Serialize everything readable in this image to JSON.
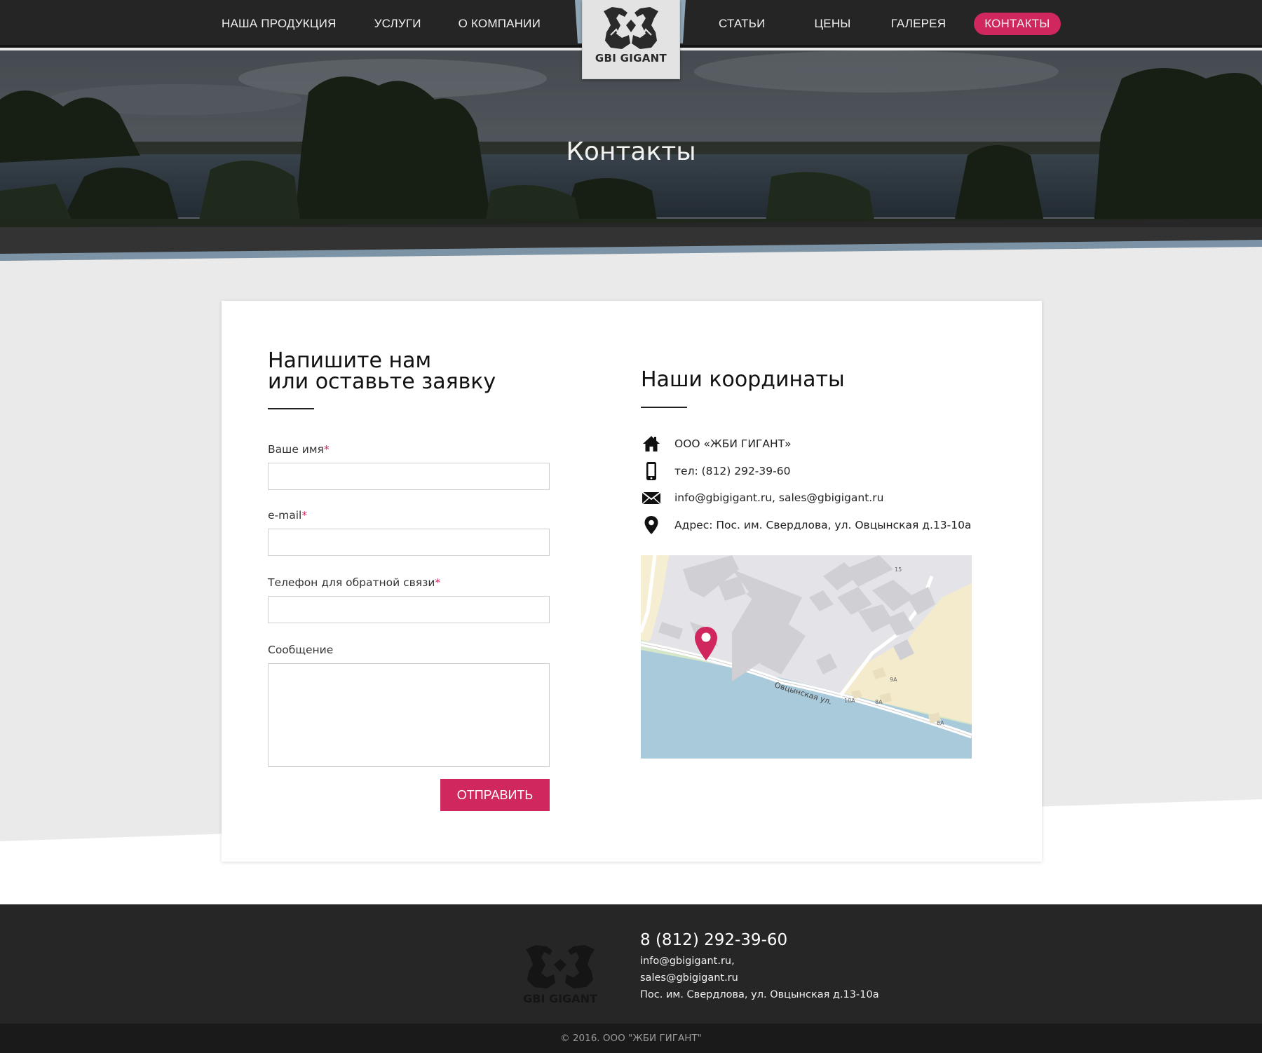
{
  "nav": {
    "left": [
      "НАША ПРОДУКЦИЯ",
      "УСЛУГИ",
      "О КОМПАНИИ"
    ],
    "right": [
      "СТАТЬИ",
      "ЦЕНЫ",
      "ГАЛЕРЕЯ"
    ],
    "active": "КОНТАКТЫ"
  },
  "logo": {
    "text": "GBI GIGANT"
  },
  "hero": {
    "title": "Контакты"
  },
  "form": {
    "title_line1": "Напишите нам",
    "title_line2": "или оставьте заявку",
    "name_label": "Ваше имя",
    "email_label": "e-mail",
    "phone_label": "Телефон для обратной связи",
    "message_label": "Сообщение",
    "required_mark": "*",
    "name_value": "",
    "email_value": "",
    "phone_value": "",
    "message_value": "",
    "submit": "ОТПРАВИТЬ"
  },
  "coords": {
    "title": "Наши координаты",
    "company": "ООО «ЖБИ ГИГАНТ»",
    "phone": "тел: (812) 292-39-60",
    "email": "info@gbigigant.ru, sales@gbigigant.ru",
    "address": "Адрес: Пос. им. Свердлова, ул. Овцынская д.13-10а",
    "icons": [
      "home-icon",
      "mobile-phone-icon",
      "envelope-icon",
      "map-pin-icon"
    ]
  },
  "map": {
    "street": "Овцынская ул.",
    "labels": [
      "15",
      "9А",
      "10А",
      "8А",
      "6А"
    ]
  },
  "footer": {
    "phone": "8 (812) 292-39-60",
    "email1": "info@gbigigant.ru,",
    "email2": "sales@gbigigant.ru",
    "address": "Пос. им. Свердлова, ул. Овцынская д.13-10а",
    "logo_text": "GBI GIGANT",
    "copyright": "© 2016. ООО \"ЖБИ ГИГАНТ\""
  },
  "colors": {
    "accent": "#d0285e",
    "dark": "#252525",
    "background": "#eaeaea",
    "sky_stripe": "#8fa6b5"
  }
}
